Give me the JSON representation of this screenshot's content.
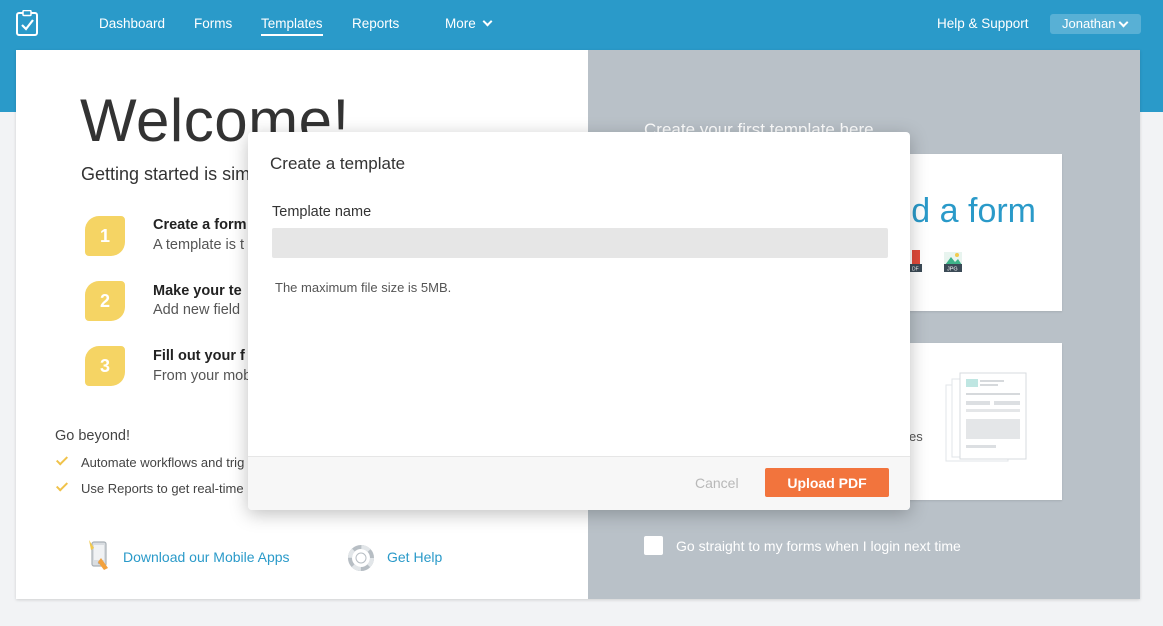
{
  "nav": {
    "items": [
      {
        "label": "Dashboard"
      },
      {
        "label": "Forms"
      },
      {
        "label": "Templates"
      },
      {
        "label": "Reports"
      },
      {
        "label": "More"
      }
    ],
    "active": "Templates",
    "help_label": "Help & Support",
    "user_label": "Jonathan"
  },
  "welcome": {
    "title": "Welcome!",
    "subtitle": "Getting started is sim",
    "steps": [
      {
        "number": "1",
        "title": "Create a form",
        "subtitle": "A template is t"
      },
      {
        "number": "2",
        "title": "Make your te",
        "subtitle": "Add new field"
      },
      {
        "number": "3",
        "title": "Fill out your f",
        "subtitle": "From your mob"
      }
    ],
    "go_beyond_title": "Go beyond!",
    "go_beyond_items": [
      "Automate workflows and trig",
      "Use Reports to get real-time"
    ],
    "mobile_link": "Download our Mobile Apps",
    "help_link": "Get Help"
  },
  "right_panel": {
    "title": "Create your first template here",
    "upload_card_text": "d a form",
    "pdf_icon_label": "DF",
    "jpg_icon_label": "JPG",
    "template_card_fragment": "es",
    "go_straight_label": "Go straight to my forms when I login next time"
  },
  "modal": {
    "title": "Create a template",
    "field_label": "Template name",
    "field_value": "",
    "field_placeholder": "",
    "hint": "The maximum file size is 5MB.",
    "cancel_label": "Cancel",
    "upload_label": "Upload PDF"
  },
  "colors": {
    "brand": "#2a9ac9",
    "accent": "#f2743d",
    "step_badge": "#f5d464",
    "right_panel": "#b9c1c8"
  }
}
